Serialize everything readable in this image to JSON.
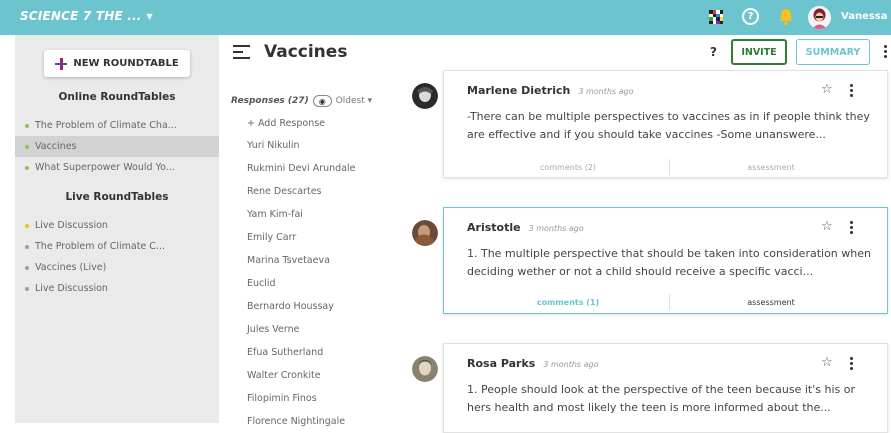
{
  "topbar": {
    "course_title": "SCIENCE 7 THE ...",
    "user_name": "Vanessa"
  },
  "sidebar": {
    "new_button_label": "NEW ROUNDTABLE",
    "online_heading": "Online RoundTables",
    "online_items": [
      {
        "label": "The Problem of Climate Cha...",
        "dot": "#8bc34a",
        "active": false
      },
      {
        "label": "Vaccines",
        "dot": "#8bc34a",
        "active": true
      },
      {
        "label": "What Superpower Would Yo...",
        "dot": "#8bc34a",
        "active": false
      }
    ],
    "live_heading": "Live RoundTables",
    "live_items": [
      {
        "label": "Live Discussion",
        "dot": "#f4c20d"
      },
      {
        "label": "The Problem of Climate C...",
        "dot": "#9e9e9e"
      },
      {
        "label": "Vaccines (Live)",
        "dot": "#9e9e9e"
      },
      {
        "label": "Live Discussion",
        "dot": "#9e9e9e"
      }
    ]
  },
  "main": {
    "title": "Vaccines",
    "responses_label": "Responses (27)",
    "sort_label": "Oldest",
    "add_response": "+ Add Response",
    "respondents": [
      "Yuri Nikulin",
      "Rukmini Devi Arundale",
      "Rene Descartes",
      "Yam Kim-fai",
      "Emily Carr",
      "Marina Tsvetaeva",
      "Euclid",
      "Bernardo Houssay",
      "Jules Verne",
      "Efua Sutherland",
      "Walter Cronkite",
      "Filopimin Finos",
      "Florence Nightingale"
    ]
  },
  "actions": {
    "help": "?",
    "invite": "INVITE",
    "summary": "SUMMARY"
  },
  "cards": [
    {
      "name": "Marlene Dietrich",
      "time": "3 months ago",
      "body": "-There can be multiple perspectives to vaccines as in if people think they are effective and if you should take vaccines -Some unanswere...",
      "comments": "comments (2)",
      "assessment": "assessment",
      "selected": false
    },
    {
      "name": "Aristotle",
      "time": "3 months ago",
      "body": "1. The multiple perspective that should be taken into consideration when deciding wether or not a child should receive a specific vacci...",
      "comments": "comments (1)",
      "assessment": "assessment",
      "selected": true
    },
    {
      "name": "Rosa Parks",
      "time": "3 months ago",
      "body": "1. People should look at the perspective of the teen because it's his or hers health and most likely the teen is more informed about the...",
      "comments": "",
      "assessment": "",
      "selected": false
    }
  ],
  "colors": {
    "brand": "#6cc4cf",
    "invite": "#2e7d32",
    "sidebar_bg": "#eaeaea"
  },
  "icons": [
    "caret-down-icon",
    "apps-grid-icon",
    "help-icon",
    "bell-icon",
    "avatar",
    "plus-icon",
    "menu-icon",
    "eye-icon",
    "star-icon",
    "kebab-icon"
  ]
}
